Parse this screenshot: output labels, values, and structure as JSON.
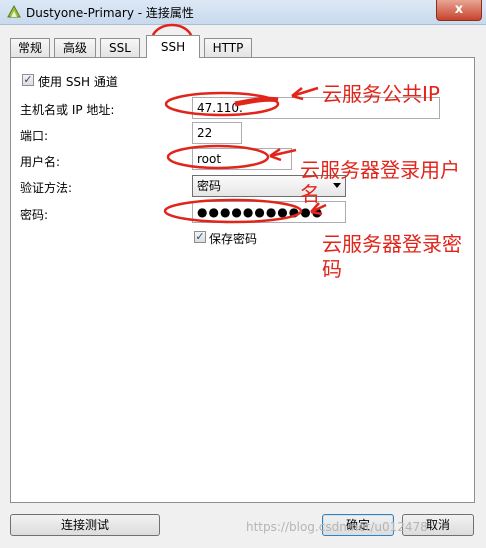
{
  "window": {
    "title": "Dustyone-Primary - 连接属性",
    "close_label": "x"
  },
  "tabs": [
    {
      "label": "常规"
    },
    {
      "label": "高级"
    },
    {
      "label": "SSL"
    },
    {
      "label": "SSH"
    },
    {
      "label": "HTTP"
    }
  ],
  "ssh": {
    "use_ssh_label": "使用 SSH 通道",
    "host_label": "主机名或 IP 地址:",
    "host_value": "47.110.",
    "port_label": "端口:",
    "port_value": "22",
    "user_label": "用户名:",
    "user_value": "root",
    "auth_label": "验证方法:",
    "auth_value": "密码",
    "password_label": "密码:",
    "password_value": "●●●●●●●●●●●",
    "save_password_label": "保存密码"
  },
  "annotations": {
    "ip": "云服务公共IP",
    "user_line1": "云服务器登录用户",
    "user_line2": "名",
    "pwd_line1": "云服务器登录密",
    "pwd_line2": "码",
    "color": "#e1251b"
  },
  "buttons": {
    "test": "连接测试",
    "ok": "确定",
    "cancel": "取消"
  },
  "watermark": "https://blog.csdn.net/u012478"
}
